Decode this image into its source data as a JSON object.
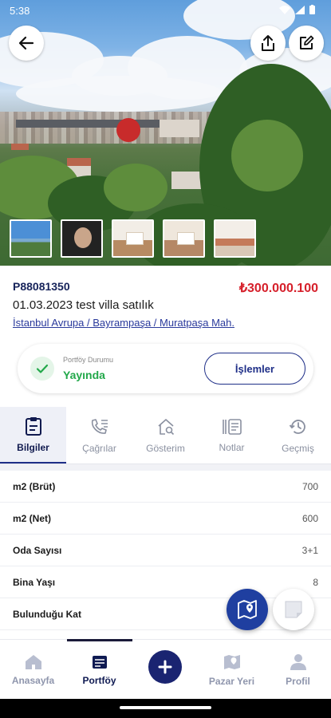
{
  "status_bar": {
    "time": "5:38"
  },
  "listing": {
    "code": "P88081350",
    "price": "₺300.000.100",
    "title": "01.03.2023 test villa satılık",
    "location": "İstanbul Avrupa / Bayrampaşa / Muratpaşa Mah."
  },
  "portfolio_status": {
    "label": "Portföy Durumu",
    "value": "Yayında",
    "actions_label": "İşlemler"
  },
  "tabs": [
    {
      "label": "Bilgiler",
      "icon": "clipboard-icon",
      "active": true
    },
    {
      "label": "Çağrılar",
      "icon": "phone-list-icon",
      "active": false
    },
    {
      "label": "Gösterim",
      "icon": "house-search-icon",
      "active": false
    },
    {
      "label": "Notlar",
      "icon": "notes-list-icon",
      "active": false
    },
    {
      "label": "Geçmiş",
      "icon": "history-icon",
      "active": false
    }
  ],
  "details": [
    {
      "key": "m2 (Brüt)",
      "value": "700"
    },
    {
      "key": "m2 (Net)",
      "value": "600"
    },
    {
      "key": "Oda Sayısı",
      "value": "3+1"
    },
    {
      "key": "Bina Yaşı",
      "value": "8"
    },
    {
      "key": "Bulunduğu Kat",
      "value": ""
    }
  ],
  "bottom_nav": [
    {
      "label": "Anasayfa",
      "icon": "home-icon",
      "active": false
    },
    {
      "label": "Portföy",
      "icon": "portfolio-icon",
      "active": true
    },
    {
      "label": "Pazar Yeri",
      "icon": "map-marker-icon",
      "active": false
    },
    {
      "label": "Profil",
      "icon": "profile-icon",
      "active": false
    }
  ],
  "colors": {
    "brand_navy": "#1a2471",
    "price_red": "#d6202b",
    "live_green": "#22a84a",
    "link_blue": "#2a3a9c"
  }
}
